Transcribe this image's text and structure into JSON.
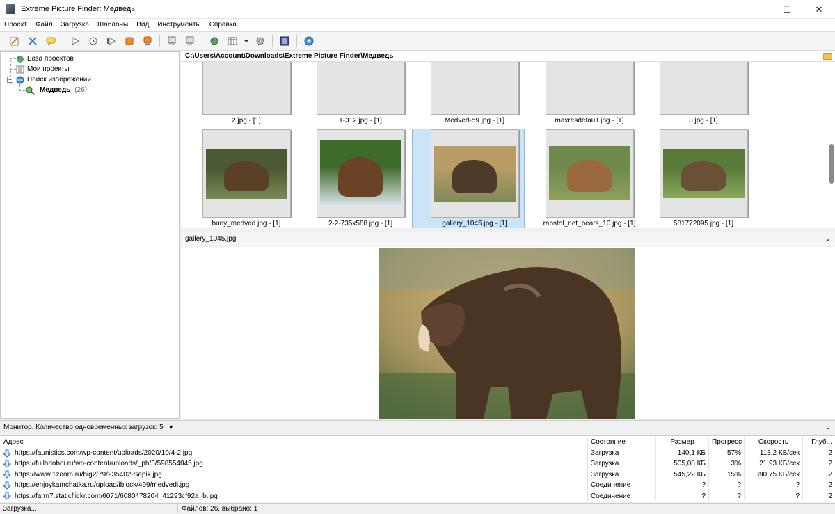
{
  "window": {
    "title": "Extreme Picture Finder: Медведь",
    "minimize": "—",
    "maximize": "☐",
    "close": "✕"
  },
  "menu": [
    "Проект",
    "Файл",
    "Загрузка",
    "Шаблоны",
    "Вид",
    "Инструменты",
    "Справка"
  ],
  "toolbar": {
    "icons": [
      "edit-project-icon",
      "project-settings-icon",
      "comment-icon",
      "start-icon",
      "schedule-icon",
      "resume-icon",
      "stop-icon",
      "stop-all-icon",
      "prev-page-icon",
      "next-page-icon",
      "search-web-icon",
      "view-mode-icon",
      "dropdown-arrow-icon",
      "settings-gear-icon",
      "gallery-icon",
      "help-icon"
    ]
  },
  "tree": {
    "items": [
      {
        "label": "База проектов",
        "count": ""
      },
      {
        "label": "Мои проекты",
        "count": ""
      },
      {
        "label": "Поиск изображений",
        "count": ""
      },
      {
        "label": "Медведь",
        "count": "(26)"
      }
    ]
  },
  "path": "C:\\Users\\Account\\Downloads\\Extreme Picture Finder\\Медведь",
  "thumbnails": [
    {
      "label": "2.jpg - [1]",
      "colors": [
        "#6a5a3c",
        "#3f3324",
        "#7f8f57"
      ]
    },
    {
      "label": "1-312.jpg - [1]",
      "colors": [
        "#58703d",
        "#2f2a1f",
        "#8a9a5a"
      ]
    },
    {
      "label": "Medved-59.jpg - [1]",
      "colors": [
        "#7a6a55",
        "#4a3b2c",
        "#aaa49a"
      ]
    },
    {
      "label": "maxresdefault.jpg - [1]",
      "colors": [
        "#ffffff",
        "#1a1a1a",
        "#f4f4f4"
      ]
    },
    {
      "label": "3.jpg - [1]",
      "colors": [
        "#7a6848",
        "#3c2e20",
        "#9a8a5a"
      ]
    },
    {
      "label": "buriy_medved.jpg - [1]",
      "colors": [
        "#4b5a34",
        "#5a4028",
        "#7a8a55"
      ]
    },
    {
      "label": "2-2-735x588.jpg - [1]",
      "colors": [
        "#3e6a2a",
        "#6a4226",
        "#dfe8ee"
      ]
    },
    {
      "label": "gallery_1045.jpg - [1]",
      "colors": [
        "#b89c66",
        "#4e3a28",
        "#7e8a5a"
      ]
    },
    {
      "label": "rabstol_net_bears_10.jpg - [1]",
      "colors": [
        "#6e8a4a",
        "#9a6a3e",
        "#8ea060"
      ]
    },
    {
      "label": "581772095.jpg - [1]",
      "colors": [
        "#5a7a3a",
        "#6a5036",
        "#8aa65a"
      ]
    }
  ],
  "preview": {
    "filename": "gallery_1045.jpg"
  },
  "monitor": {
    "label": "Монитор. Количество одновременных загрузок: 5"
  },
  "downloads": {
    "headers": {
      "url": "Адрес",
      "state": "Состояние",
      "size": "Размер",
      "progress": "Прогресс",
      "speed": "Скорость",
      "depth": "Глуб..."
    },
    "rows": [
      {
        "url": "https://faunistics.com/wp-content/uploads/2020/10/4-2.jpg",
        "state": "Загрузка",
        "size": "140,1 КБ",
        "progress": "57%",
        "speed": "113,2 КБ/сек",
        "depth": "2"
      },
      {
        "url": "https://fullhdoboi.ru/wp-content/uploads/_ph/3/598554845.jpg",
        "state": "Загрузка",
        "size": "505,08 КБ",
        "progress": "3%",
        "speed": "21,93 КБ/сек",
        "depth": "2"
      },
      {
        "url": "https://www.1zoom.ru/big2/79/235402-Sepik.jpg",
        "state": "Загрузка",
        "size": "545,22 КБ",
        "progress": "15%",
        "speed": "390,75 КБ/сек",
        "depth": "2"
      },
      {
        "url": "https://enjoykamchatka.ru/upload/iblock/499/medvedi.jpg",
        "state": "Соединение",
        "size": "?",
        "progress": "?",
        "speed": "?",
        "depth": "2"
      },
      {
        "url": "https://farm7.staticflickr.com/6071/6080478204_41293cf92a_b.jpg",
        "state": "Соединение",
        "size": "?",
        "progress": "?",
        "speed": "?",
        "depth": "2"
      }
    ]
  },
  "status": {
    "left": "Загрузка...",
    "files": "Файлов: 26, выбрано: 1"
  }
}
